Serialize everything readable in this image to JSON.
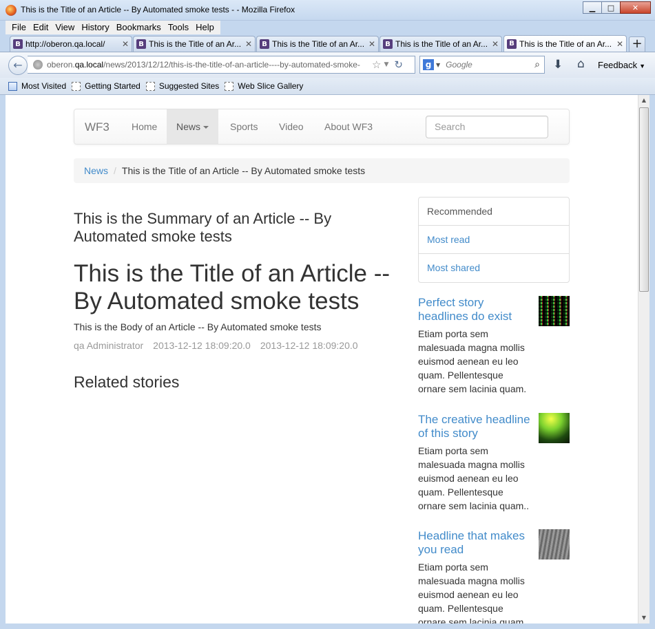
{
  "window": {
    "title": "This is the Title of an Article -- By Automated smoke tests - - Mozilla Firefox",
    "minimize": "▁",
    "maximize": "□",
    "close": "✕"
  },
  "menu": [
    "File",
    "Edit",
    "View",
    "History",
    "Bookmarks",
    "Tools",
    "Help"
  ],
  "tabs": [
    {
      "favicon": "B",
      "label": "http://oberon.qa.local/",
      "close": "✕"
    },
    {
      "favicon": "B",
      "label": "This is the Title of an Ar...",
      "close": "✕"
    },
    {
      "favicon": "B",
      "label": "This is the Title of an Ar...",
      "close": "✕"
    },
    {
      "favicon": "B",
      "label": "This is the Title of an Ar...",
      "close": "✕"
    },
    {
      "favicon": "B",
      "label": "This is the Title of an Ar...",
      "close": "✕"
    }
  ],
  "new_tab": "+",
  "url": {
    "prefix": "oberon.",
    "host": "qa.local",
    "path": "/news/2013/12/12/this-is-the-title-of-an-article----by-automated-smoke-"
  },
  "search_engine": {
    "letter": "g",
    "placeholder": "Google"
  },
  "feedback": "Feedback",
  "bookmarks": [
    "Most Visited",
    "Getting Started",
    "Suggested Sites",
    "Web Slice Gallery"
  ],
  "site": {
    "brand": "WF3",
    "nav": [
      "Home",
      "News",
      "Sports",
      "Video",
      "About WF3"
    ],
    "search_placeholder": "Search",
    "breadcrumb": {
      "link": "News",
      "separator": "/",
      "current": "This is the Title of an Article -- By Automated smoke tests"
    },
    "summary": "This is the Summary of an Article -- By Automated smoke tests",
    "title": "This is the Title of an Article -- By Automated smoke tests",
    "body": "This is the Body of an Article -- By Automated smoke tests",
    "meta": {
      "author": "qa Administrator",
      "created": "2013-12-12 18:09:20.0",
      "updated": "2013-12-12 18:09:20.0"
    },
    "related_heading": "Related stories",
    "sidebar": {
      "header": "Recommended",
      "links": [
        "Most read",
        "Most shared"
      ],
      "stories": [
        {
          "headline": "Perfect story headlines do exist",
          "text": "Etiam porta sem malesuada magna mollis euismod aenean eu leo quam. Pellentesque ornare sem lacinia quam."
        },
        {
          "headline": "The creative headline of this story",
          "text": "Etiam porta sem malesuada magna mollis euismod aenean eu leo quam. Pellentesque ornare sem lacinia quam.."
        },
        {
          "headline": "Headline that makes you read",
          "text": "Etiam porta sem malesuada magna mollis euismod aenean eu leo quam. Pellentesque ornare sem lacinia quam."
        }
      ]
    }
  }
}
